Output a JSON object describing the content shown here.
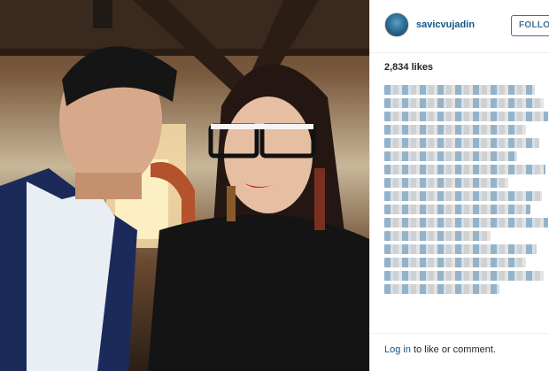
{
  "post": {
    "username": "savicvujadin",
    "follow_label": "FOLLOW",
    "likes": "2,834 likes"
  },
  "footer": {
    "login_link": "Log in",
    "login_text": " to like or comment."
  },
  "colors": {
    "link": "#125688",
    "follow_border": "#3f729b"
  }
}
